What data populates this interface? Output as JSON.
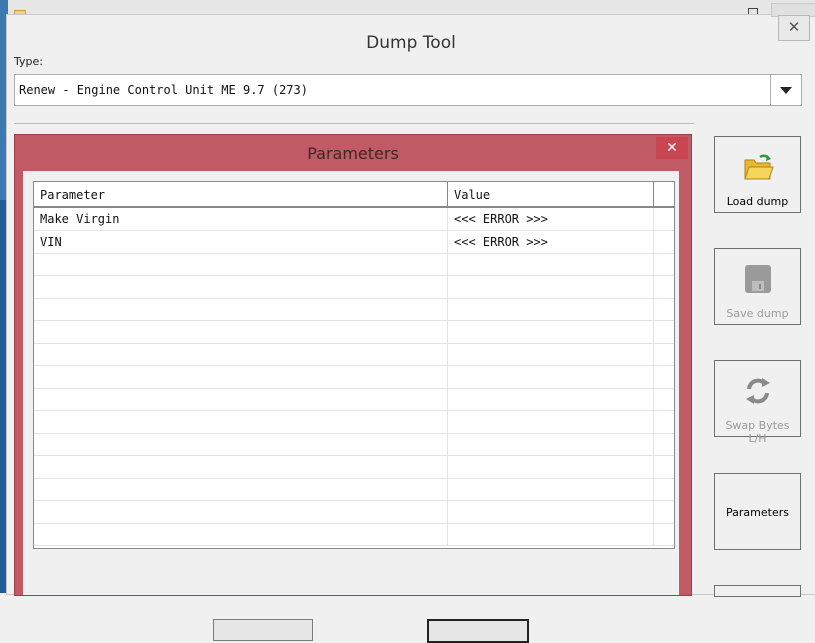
{
  "window": {
    "title": "Dump Tool",
    "close_glyph": "✕"
  },
  "type": {
    "label": "Type:",
    "selected": "Renew - Engine Control Unit ME 9.7 (273)"
  },
  "parameters_dialog": {
    "title": "Parameters",
    "close_glyph": "✕",
    "columns": [
      "Parameter",
      "Value"
    ],
    "rows": [
      {
        "parameter": "Make Virgin",
        "value": "<<< ERROR >>>"
      },
      {
        "parameter": "VIN",
        "value": "<<< ERROR >>>"
      }
    ]
  },
  "side_buttons": {
    "load": {
      "label": "Load dump",
      "icon": "folder-open-icon"
    },
    "save": {
      "label": "Save dump",
      "icon": "save-disk-icon"
    },
    "swap": {
      "label": "Swap Bytes L/H",
      "icon": "swap-arrows-icon"
    },
    "parameters": {
      "label": "Parameters"
    }
  },
  "colors": {
    "dialog_frame": "#c05a64",
    "close_button": "#c94552"
  }
}
